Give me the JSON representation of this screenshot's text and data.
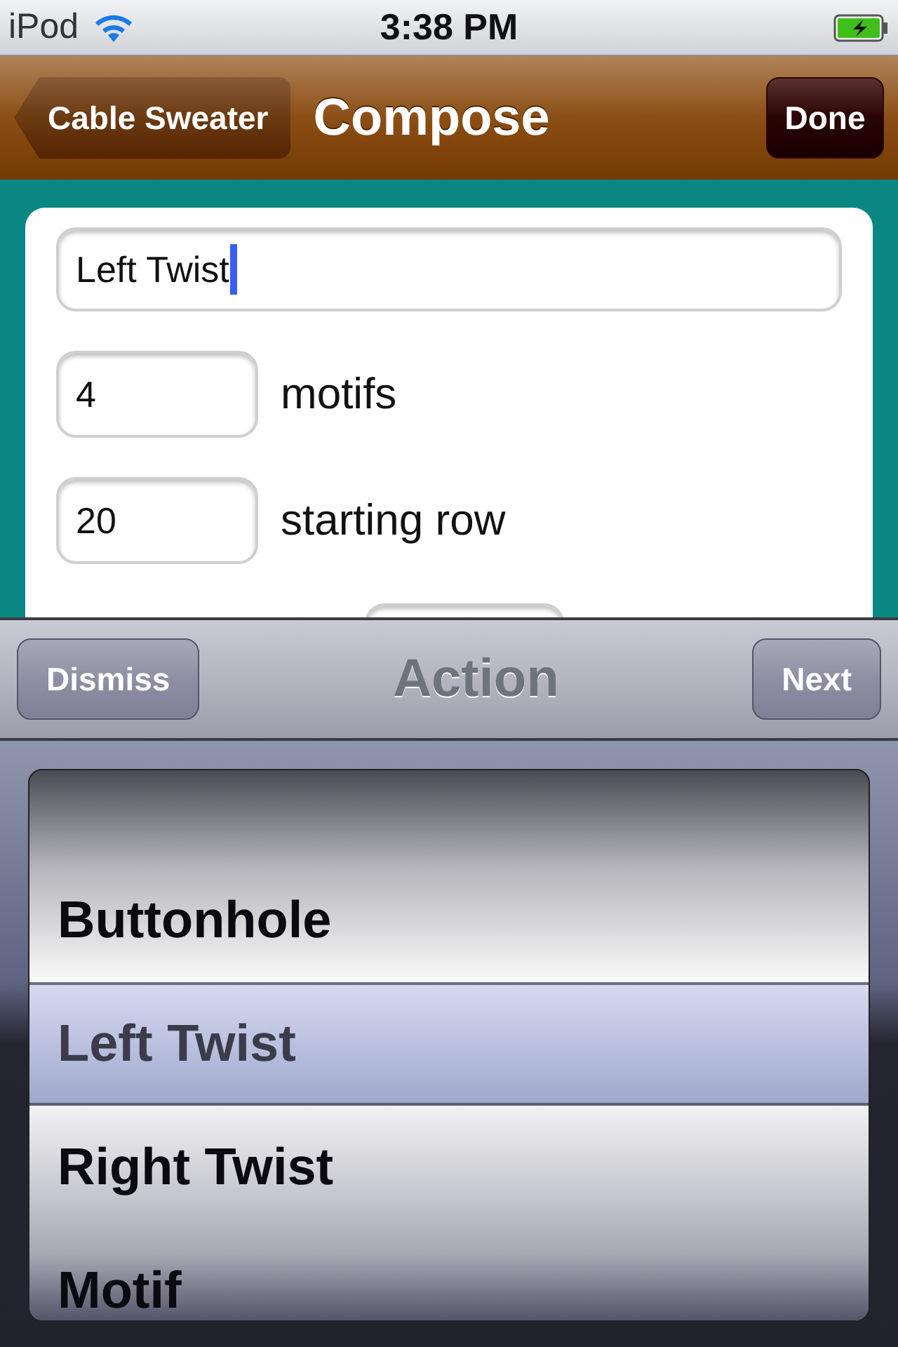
{
  "status_bar": {
    "carrier": "iPod",
    "time": "3:38 PM",
    "charging": true
  },
  "nav_bar": {
    "back": "Cable Sweater",
    "title": "Compose",
    "done": "Done"
  },
  "form": {
    "name_field": {
      "value": "Left Twist",
      "focused": true
    },
    "rows": [
      {
        "value": "4",
        "label": "motifs"
      },
      {
        "value": "20",
        "label": "starting row"
      }
    ]
  },
  "toolbar": {
    "left": "Dismiss",
    "title": "Action",
    "right": "Next"
  },
  "picker": {
    "items": [
      {
        "label": "Buttonhole",
        "selected": false
      },
      {
        "label": "Left Twist",
        "selected": true
      },
      {
        "label": "Right Twist",
        "selected": false
      },
      {
        "label": "Motif",
        "selected": false
      }
    ]
  }
}
